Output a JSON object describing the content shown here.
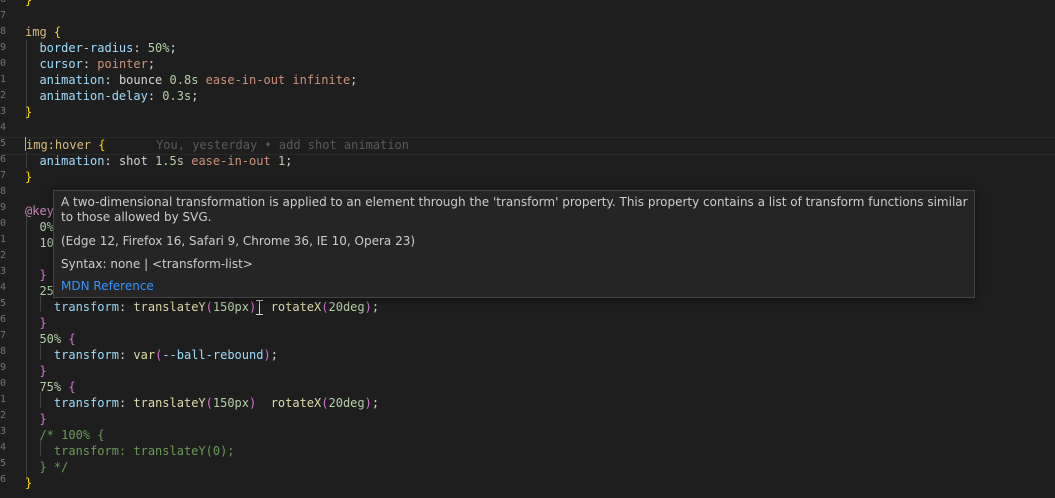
{
  "gutter": {
    "line_numbers": [
      "6",
      "7",
      "8",
      "9",
      "0",
      "1",
      "2",
      "3",
      "4",
      "5",
      "6",
      "7",
      "8",
      "9",
      "0",
      "1",
      "2",
      "3",
      "4",
      "5",
      "6",
      "7",
      "8",
      "9",
      "0",
      "1",
      "2",
      "3",
      "4",
      "5",
      "6"
    ]
  },
  "code": {
    "l0": "}",
    "l2_sel": "img",
    "l2_brace": "{",
    "l3_prop": "border-radius",
    "l3_val": "50%",
    "l4_prop": "cursor",
    "l4_val": "pointer",
    "l5_prop": "animation",
    "l5_name": "bounce",
    "l5_dur": "0.8s",
    "l5_rest": "ease-in-out infinite",
    "l6_prop": "animation-delay",
    "l6_val": "0.3s",
    "l7": "}",
    "l9_sel": "img:hover",
    "l9_brace": "{",
    "blame": "You, yesterday • add shot animation",
    "l10_prop": "animation",
    "l10_name": "shot",
    "l10_dur": "1.5s",
    "l10_ease": "ease-in-out",
    "l10_count": "1",
    "l11": "}",
    "l13_at": "@key",
    "l14_pct": "0%",
    "l15_pct": "10",
    "l17": "}",
    "l18_pct": "25",
    "l19_prop": "transform",
    "l19_fn1": "translateY",
    "l19_arg1": "150px",
    "l19_fn2": "rotateX",
    "l19_arg2": "20deg",
    "l20": "}",
    "l21_pct": "50%",
    "l21_brace": "{",
    "l22_prop": "transform",
    "l22_fn": "var",
    "l22_arg": "--ball-rebound",
    "l23": "}",
    "l24_pct": "75%",
    "l24_brace": "{",
    "l25_prop": "transform",
    "l25_fn1": "translateY",
    "l25_arg1": "150px",
    "l25_fn2": "rotateX",
    "l25_arg2": "20deg",
    "l26": "}",
    "l27": "/* 100% {",
    "l28": "transform: translateY(0);",
    "l29": "} */",
    "l30": "}"
  },
  "hover": {
    "description": "A two-dimensional transformation is applied to an element through the 'transform' property. This property contains a list of transform functions similar to those allowed by SVG.",
    "compat": "(Edge 12, Firefox 16, Safari 9, Chrome 36, IE 10, Opera 23)",
    "syntax": "Syntax: none | <transform-list>",
    "link": "MDN Reference"
  },
  "colors": {
    "background": "#1e1e1e",
    "selector": "#d7ba7d",
    "property": "#9cdcfe",
    "number": "#b5cea8",
    "string_value": "#ce9178",
    "function": "#dcdcaa",
    "comment": "#6a9955",
    "link": "#3794ff"
  }
}
